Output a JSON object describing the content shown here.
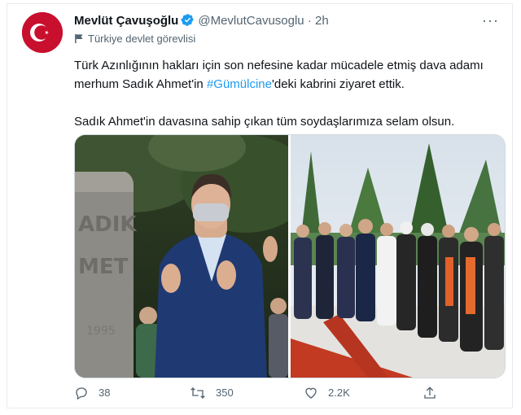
{
  "tweet": {
    "author_name": "Mevlüt Çavuşoğlu",
    "handle": "@MevlutCavusoglu",
    "separator": "·",
    "time": "2h",
    "more": "···",
    "label": "Türkiye devlet görevlisi",
    "text_line1_before": "Türk Azınlığının hakları için son nefesine kadar mücadele etmiş dava adamı merhum Sadık Ahmet'in ",
    "hashtag": "#Gümülcine",
    "text_line1_after": "'deki kabrini ziyaret ettik.",
    "text_paragraph2": "Sadık Ahmet'in davasına sahip çıkan tüm soydaşlarımıza selam olsun.",
    "tombstone_text": "ADIK\nMET\n1995",
    "media_count": 2
  },
  "actions": {
    "reply_count": "38",
    "retweet_count": "350",
    "like_count": "2.2K"
  },
  "icons": {
    "reply": "speech-bubble-icon",
    "retweet": "retweet-arrows-icon",
    "like": "heart-icon",
    "share": "share-upload-icon",
    "verified": "verified-badge-icon",
    "label": "flag-icon"
  },
  "colors": {
    "accent": "#1d9bf0",
    "secondary_text": "#536471",
    "avatar_red": "#b00d1a"
  }
}
